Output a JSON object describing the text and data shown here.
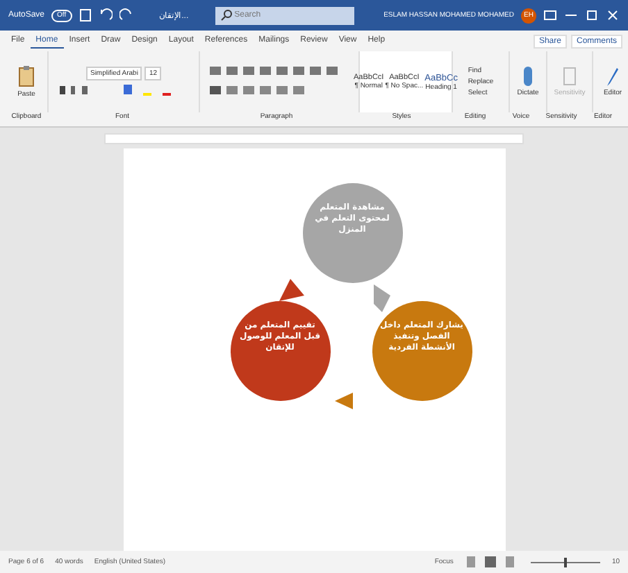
{
  "title_bar": {
    "autosave": "AutoSave",
    "autosave_toggle": {
      "on": false,
      "label": "Off"
    },
    "doc_title": "الإتقان...",
    "search_placeholder": "Search",
    "user": "ESLAM HASSAN MOHAMED MOHAMED",
    "initials": "EH"
  },
  "tabs": [
    {
      "label": "File",
      "selected": false
    },
    {
      "label": "Home",
      "selected": true
    },
    {
      "label": "Insert",
      "selected": false
    },
    {
      "label": "Draw",
      "selected": false
    },
    {
      "label": "Design",
      "selected": false
    },
    {
      "label": "Layout",
      "selected": false
    },
    {
      "label": "References",
      "selected": false
    },
    {
      "label": "Mailings",
      "selected": false
    },
    {
      "label": "Review",
      "selected": false
    },
    {
      "label": "View",
      "selected": false
    },
    {
      "label": "Help",
      "selected": false
    }
  ],
  "share": "Share",
  "comments": "Comments",
  "ribbon": {
    "paste": "Paste",
    "font_name": "Simplified Arabi",
    "font_size": "12",
    "styles": [
      {
        "preview": "AaBbCcI",
        "label": "¶ Normal",
        "kind": "plain"
      },
      {
        "preview": "AaBbCcI",
        "label": "¶ No Spac...",
        "kind": "plain"
      },
      {
        "preview": "AaBbCc",
        "label": "Heading 1",
        "kind": "heading"
      }
    ],
    "editing": [
      "Find",
      "Replace",
      "Select"
    ],
    "dictate": "Dictate",
    "sensitivity": "Sensitivity",
    "editor": "Editor",
    "groups": [
      "Clipboard",
      "Font",
      "Paragraph",
      "Styles",
      "Editing",
      "Voice",
      "Sensitivity",
      "Editor"
    ]
  },
  "diagram": [
    {
      "text": "مشاهدة المتعلم لمحتوى التعلم في المنزل",
      "color": "#a6a6a6"
    },
    {
      "text": "يشارك المتعلم داخل الفصل وتنفيذ الأنشطة الفردية",
      "color": "#c8790f"
    },
    {
      "text": "تقييم المتعلم من قبل المعلم للوصول للإتقان",
      "color": "#c0391b"
    }
  ],
  "status_bar": {
    "page": "Page 6 of 6",
    "words": "40 words",
    "language": "English (United States)",
    "focus": "Focus",
    "zoom": "10",
    "zoom_slider": {
      "level": 0.5
    }
  }
}
